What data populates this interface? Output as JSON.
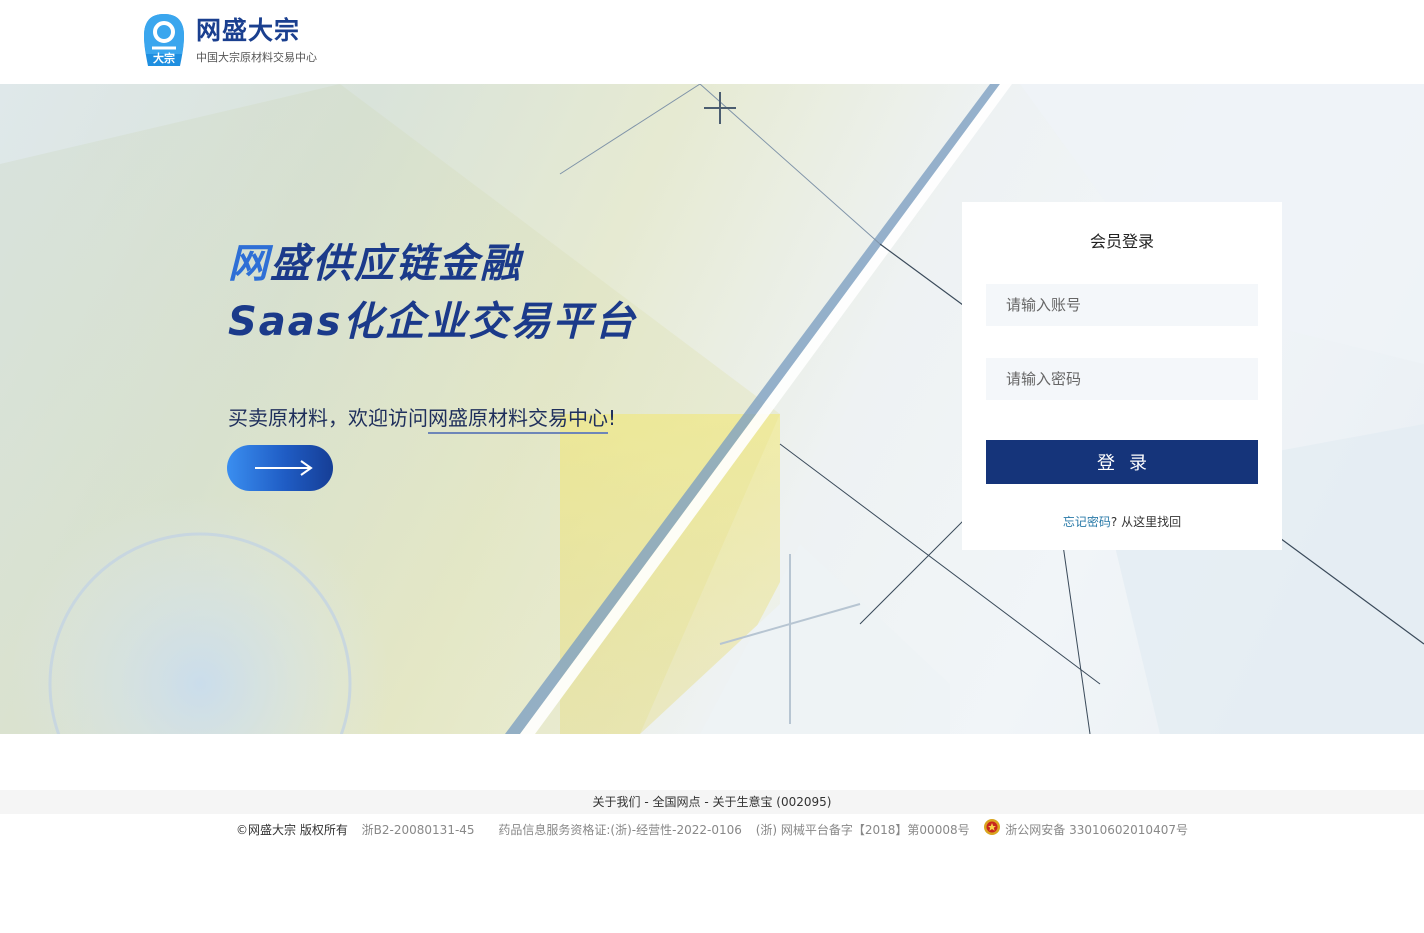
{
  "header": {
    "logo_mark_text": "大宗",
    "logo_title": "网盛大宗",
    "logo_subtitle": "中国大宗原材料交易中心"
  },
  "banner": {
    "slogan_line1_accent": "网",
    "slogan_line1_rest": "盛供应链金融",
    "slogan_line2": "Saas化企业交易平台",
    "tagline_prefix": "买卖原材料，欢迎访问",
    "tagline_highlight": "网盛原材料交易中心",
    "tagline_suffix": "!"
  },
  "login": {
    "title": "会员登录",
    "account_placeholder": "请输入账号",
    "password_placeholder": "请输入密码",
    "submit_label": "登录",
    "forgot_link": "忘记密码",
    "forgot_suffix": "? 从这里找回"
  },
  "footer": {
    "links": [
      "关于我们",
      "全国网点",
      "关于生意宝 (002095)"
    ],
    "separator": " - ",
    "copyright": "©网盛大宗 版权所有",
    "icp": "浙B2-20080131-45",
    "drug_license": "药品信息服务资格证:(浙)-经营性-2022-0106",
    "device_record": "(浙) 网械平台备字【2018】第00008号",
    "police_record": "浙公网安备 33010602010407号"
  },
  "colors": {
    "brand_navy": "#15347a",
    "brand_blue": "#2e6fd6",
    "link_teal": "#2a7aa8"
  },
  "icons": [
    "logo-mark-icon",
    "arrow-right-icon",
    "police-badge-icon"
  ]
}
